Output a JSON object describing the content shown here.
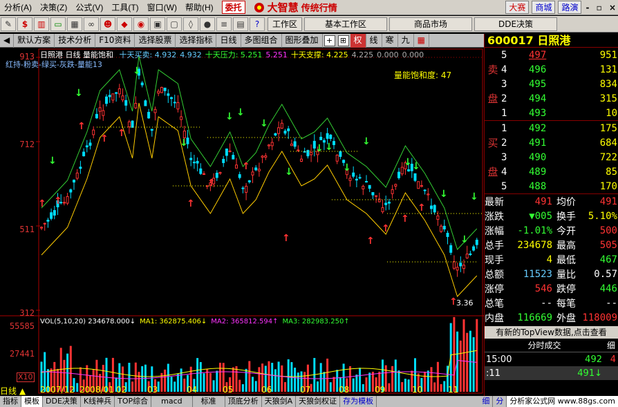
{
  "menubar": {
    "items": [
      "分析(A)",
      "决策(Z)",
      "公式(V)",
      "工具(T)",
      "窗口(W)",
      "帮助(H)"
    ],
    "weituo": "委托",
    "logo": "大智慧",
    "logo_sub": "传统行情",
    "right": [
      "大赛",
      "商城",
      "路演"
    ],
    "win_ctrl": "- ▫ ×"
  },
  "toolbar": {
    "workspace_label": "工作区",
    "workspace_value": "基本工作区",
    "market": "商品市场",
    "dde": "DDE决策"
  },
  "funcbar": {
    "items": [
      "默认方案",
      "技术分析",
      "F10资料",
      "选择股票",
      "选择指标",
      "日线",
      "多图组合",
      "图形叠加"
    ],
    "quan": "权",
    "xian": "线",
    "han": "寒",
    "jiu": "九"
  },
  "chart_header": {
    "name": "日照港",
    "period": "日线",
    "indicator": "量能饱和",
    "items": [
      {
        "text": "十天买卖: 4.932",
        "color": "#6cf"
      },
      {
        "text": "4.932",
        "color": "#6cf"
      },
      {
        "text": "十天压力: 5.251",
        "color": "#3f3"
      },
      {
        "text": "5.251",
        "color": "#f3f"
      },
      {
        "text": "十天支撑: 4.225",
        "color": "#ff0"
      },
      {
        "text": "4.225",
        "color": "#aaa"
      },
      {
        "text": "0.000",
        "color": "#aaa"
      },
      {
        "text": "0.000",
        "color": "#aaa"
      }
    ]
  },
  "legend_text": "红持-粉卖-绿买-灰跌-量能13",
  "saturation_label": "量能饱和度: 47",
  "volume_header": {
    "items": [
      {
        "text": "VOL(5,10,20) 234678.000↓",
        "color": "#fff"
      },
      {
        "text": "MA1: 362875.406↓",
        "color": "#ff0"
      },
      {
        "text": "MA2: 365812.594↑",
        "color": "#f3f"
      },
      {
        "text": "MA3: 282983.250↑",
        "color": "#3f3"
      }
    ]
  },
  "y_axis": [
    "913",
    "712",
    "511",
    "312"
  ],
  "vol_axis": [
    "55585",
    "27441"
  ],
  "vol_unit": "X10",
  "low_label": "3.36",
  "date_labels": [
    "2007/12",
    "2008/01",
    "02",
    "03",
    "04",
    "05",
    "06",
    "07",
    "08",
    "09",
    "10",
    "11"
  ],
  "period_tab": "日线",
  "chart_data": {
    "type": "candlestick",
    "name": "日照港",
    "y_ticks": [
      3.12,
      5.11,
      7.12,
      9.13
    ],
    "x_labels": [
      "2007/12",
      "2008/01",
      "02",
      "03",
      "04",
      "05",
      "06",
      "07",
      "08",
      "09",
      "10",
      "11"
    ],
    "latest": {
      "open": 5.0,
      "high": 5.05,
      "low": 4.67,
      "close": 4.91
    },
    "volume": {
      "current": 234678.0,
      "ma": [
        362875.406,
        365812.594,
        282983.25
      ],
      "ticks": [
        55585,
        27441
      ]
    }
  },
  "stock": {
    "code": "600017",
    "name": "日照港"
  },
  "orderbook": {
    "sell_label": "卖盘",
    "buy_label": "买盘",
    "sell": [
      {
        "lvl": "5",
        "price": "497",
        "vol": "951"
      },
      {
        "lvl": "4",
        "price": "496",
        "vol": "131"
      },
      {
        "lvl": "3",
        "price": "495",
        "vol": "834"
      },
      {
        "lvl": "2",
        "price": "494",
        "vol": "315"
      },
      {
        "lvl": "1",
        "price": "493",
        "vol": "10"
      }
    ],
    "buy": [
      {
        "lvl": "1",
        "price": "492",
        "vol": "175"
      },
      {
        "lvl": "2",
        "price": "491",
        "vol": "684"
      },
      {
        "lvl": "3",
        "price": "490",
        "vol": "722"
      },
      {
        "lvl": "4",
        "price": "489",
        "vol": "85"
      },
      {
        "lvl": "5",
        "price": "488",
        "vol": "170"
      }
    ]
  },
  "quotes": [
    {
      "l1": "最新",
      "v1": "491",
      "c1": "#f33",
      "l2": "均价",
      "v2": "491",
      "c2": "#f33"
    },
    {
      "l1": "涨跌",
      "v1": "▼005",
      "c1": "#3f3",
      "l2": "换手",
      "v2": "5.10%",
      "c2": "#ff0"
    },
    {
      "l1": "涨幅",
      "v1": "-1.01%",
      "c1": "#3f3",
      "l2": "今开",
      "v2": "500",
      "c2": "#f33"
    },
    {
      "l1": "总手",
      "v1": "234678",
      "c1": "#ff0",
      "l2": "最高",
      "v2": "505",
      "c2": "#f33"
    },
    {
      "l1": "现手",
      "v1": "4",
      "c1": "#ff0",
      "l2": "最低",
      "v2": "467",
      "c2": "#3f3"
    },
    {
      "l1": "总额",
      "v1": "11523",
      "c1": "#6cf",
      "l2": "量比",
      "v2": "0.57",
      "c2": "#fff"
    },
    {
      "l1": "涨停",
      "v1": "546",
      "c1": "#f33",
      "l2": "跌停",
      "v2": "446",
      "c2": "#3f3"
    },
    {
      "l1": "总笔",
      "v1": "--",
      "c1": "#fff",
      "l2": "每笔",
      "v2": "--",
      "c2": "#fff"
    },
    {
      "l1": "内盘",
      "v1": "116669",
      "c1": "#3f3",
      "l2": "外盘",
      "v2": "118009",
      "c2": "#f33"
    }
  ],
  "topview": "有新的TopView数据,点击查看",
  "ticks_header": {
    "title": "分时成交",
    "right": "细"
  },
  "ticks": [
    {
      "time": "15:00",
      "price": "492",
      "vol": "4",
      "pc": "#3f3",
      "vc": "#f33"
    },
    {
      "time": ":11",
      "price": "491↓",
      "vol": "",
      "pc": "#3f3",
      "vc": "#3f3"
    }
  ],
  "bottombar": {
    "items": [
      "指标",
      "模板",
      "DDE决策",
      "K线神兵",
      "TOP综合",
      "macd",
      "标准",
      "顶底分析",
      "天狼剑A",
      "天狼剑权证",
      "存为模板"
    ],
    "right": "分析家公式网 www.88gs.com",
    "xi": "细",
    "fen": "分"
  },
  "colors": {
    "up": "#ff3333",
    "down": "#00ffff",
    "ma_green": "#33cc33",
    "support": "#ffcc00"
  }
}
